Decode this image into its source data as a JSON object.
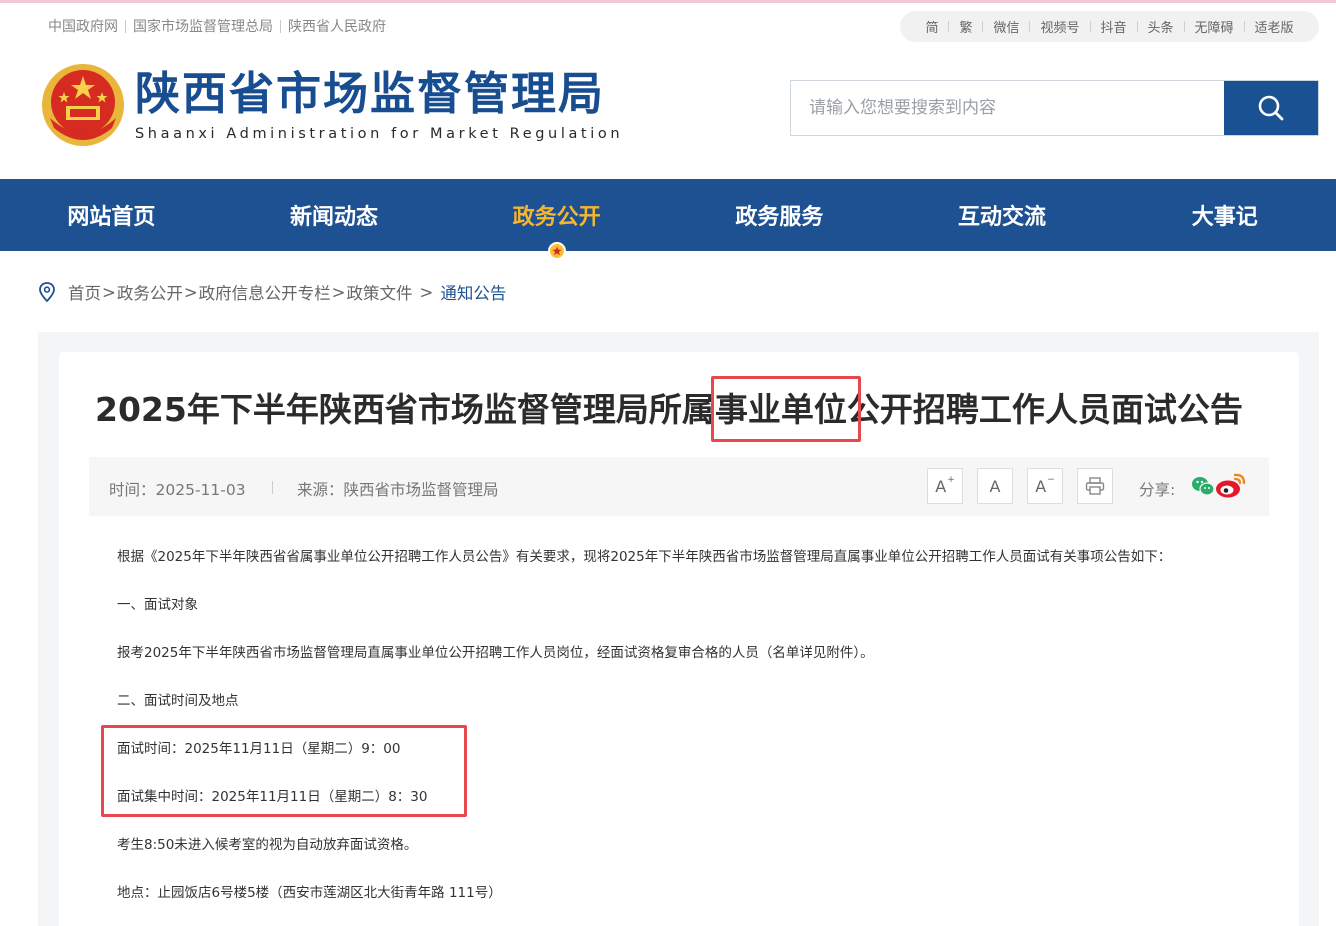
{
  "top_links": [
    "中国政府网",
    "国家市场监督管理总局",
    "陕西省人民政府"
  ],
  "tools": [
    "简",
    "繁",
    "微信",
    "视频号",
    "抖音",
    "头条",
    "无障碍",
    "适老版"
  ],
  "site": {
    "title": "陕西省市场监督管理局",
    "subtitle": "Shaanxi Administration for Market Regulation"
  },
  "search": {
    "placeholder": "请输入您想要搜索到内容"
  },
  "nav": {
    "items": [
      {
        "label": "网站首页"
      },
      {
        "label": "新闻动态"
      },
      {
        "label": "政务公开"
      },
      {
        "label": "政务服务"
      },
      {
        "label": "互动交流"
      },
      {
        "label": "大事记"
      }
    ],
    "active": "政务公开"
  },
  "breadcrumb": {
    "items": [
      "首页",
      "政务公开",
      "政府信息公开专栏",
      "政策文件"
    ],
    "current": "通知公告"
  },
  "article": {
    "title": "2025年下半年陕西省市场监督管理局所属事业单位公开招聘工作人员面试公告",
    "time": "时间：2025-11-03",
    "source": "来源：陕西省市场监督管理局",
    "font_buttons": [
      "A",
      "A",
      "A"
    ],
    "share_label": "分享:",
    "paragraphs": [
      "根据《2025年下半年陕西省省属事业单位公开招聘工作人员公告》有关要求，现将2025年下半年陕西省市场监督管理局直属事业单位公开招聘工作人员面试有关事项公告如下：",
      "一、面试对象",
      "报考2025年下半年陕西省市场监督管理局直属事业单位公开招聘工作人员岗位，经面试资格复审合格的人员（名单详见附件）。",
      "二、面试时间及地点",
      "面试时间：2025年11月11日（星期二）9：00",
      "面试集中时间：2025年11月11日（星期二）8：30",
      "考生8:50未进入候考室的视为自动放弃面试资格。",
      "地点：止园饭店6号楼5楼（西安市莲湖区北大街青年路 111号）"
    ]
  },
  "colors": {
    "brand_blue": "#1d5192",
    "active_nav": "#f7b52c",
    "highlight_red": "#e5484d"
  }
}
